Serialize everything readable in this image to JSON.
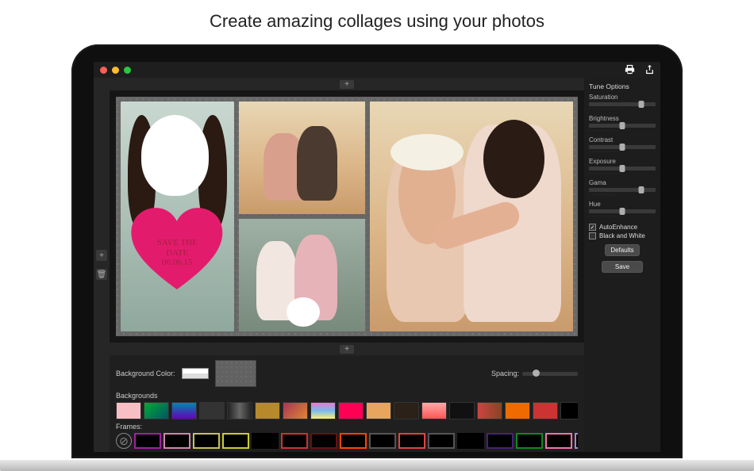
{
  "headline": "Create amazing collages using your photos",
  "heart": {
    "line1": "SAVE THE",
    "line2": "DATE",
    "line3": "06.06.15"
  },
  "toolbar": {
    "print_tip": "Print",
    "share_tip": "Share"
  },
  "rails": {
    "add_top": "+",
    "add_bottom": "+",
    "add_left": "+",
    "trash": "🗑"
  },
  "tune": {
    "title": "Tune Options",
    "sliders": [
      {
        "label": "Saturation",
        "pos": 78
      },
      {
        "label": "Brightness",
        "pos": 50
      },
      {
        "label": "Contrast",
        "pos": 50
      },
      {
        "label": "Exposure",
        "pos": 50
      },
      {
        "label": "Gama",
        "pos": 78
      },
      {
        "label": "Hue",
        "pos": 50
      }
    ],
    "autoenhance_label": "AutoEnhance",
    "autoenhance_checked": true,
    "bw_label": "Black and White",
    "bw_checked": false,
    "defaults_btn": "Defaults",
    "save_btn": "Save"
  },
  "bottom": {
    "bg_color_label": "Background Color:",
    "spacing_label": "Spacing:",
    "backgrounds_label": "Backgrounds",
    "frames_label": "Frames:",
    "bg_thumbs": [
      "#f7bfc4",
      "linear-gradient(135deg,#0a3,#056)",
      "linear-gradient(#08a,#60b)",
      "#333",
      "linear-gradient(90deg,#222,#666,#222)",
      "#b6892b",
      "linear-gradient(135deg,#a35,#d83)",
      "linear-gradient(#e7c,#7be,#fe7)",
      "#f05",
      "#e7a55d",
      "#2b2118",
      "linear-gradient(#faa,#f55)",
      "#111",
      "linear-gradient(90deg,#c44,#842)",
      "#ef6a00",
      "#c33",
      "#000",
      "#de2",
      "#1b3",
      "#fff"
    ],
    "frame_thumbs": [
      "#a020a0",
      "#c8a",
      "#c8c060",
      "#cc3",
      "#000",
      "#c33",
      "#611",
      "#f40",
      "#555",
      "#d44",
      "#555",
      "#000",
      "#427",
      "#182",
      "#e7a",
      "#a8c",
      "#9b6",
      "#222",
      "#a85",
      "#000"
    ]
  }
}
